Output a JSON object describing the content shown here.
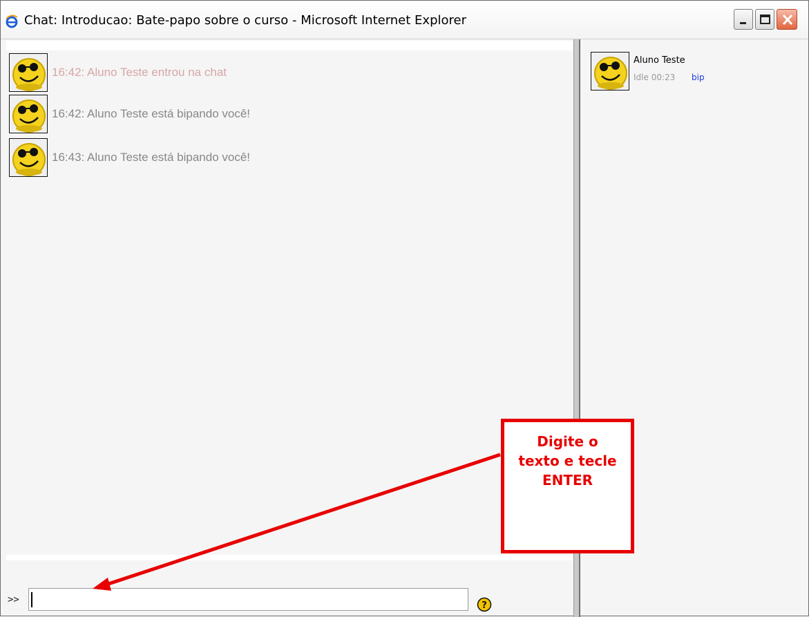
{
  "window": {
    "title": "Chat: Introducao: Bate-papo sobre o curso - Microsoft Internet Explorer"
  },
  "messages": [
    {
      "time": "16:42",
      "text": "16:42: Aluno Teste entrou na chat",
      "kind": "system"
    },
    {
      "time": "16:42",
      "text": "16:42: Aluno Teste está bipando você!",
      "kind": "beep"
    },
    {
      "time": "16:43",
      "text": "16:43: Aluno Teste está bipando você!",
      "kind": "beep"
    }
  ],
  "users": [
    {
      "name": "Aluno Teste",
      "idle": "Idle 00:23",
      "action": "bip"
    }
  ],
  "input": {
    "prompt": ">>",
    "value": "",
    "placeholder": ""
  },
  "callout": {
    "text": "Digite o texto e tecle ENTER",
    "color": "#e80000"
  },
  "colors": {
    "system_message": "#d7a6a6",
    "message": "#888888",
    "link": "#1a3bd4"
  },
  "icons": {
    "browser": "internet-explorer-icon",
    "avatar": "smiley-sunglasses-icon",
    "help": "help-icon"
  }
}
